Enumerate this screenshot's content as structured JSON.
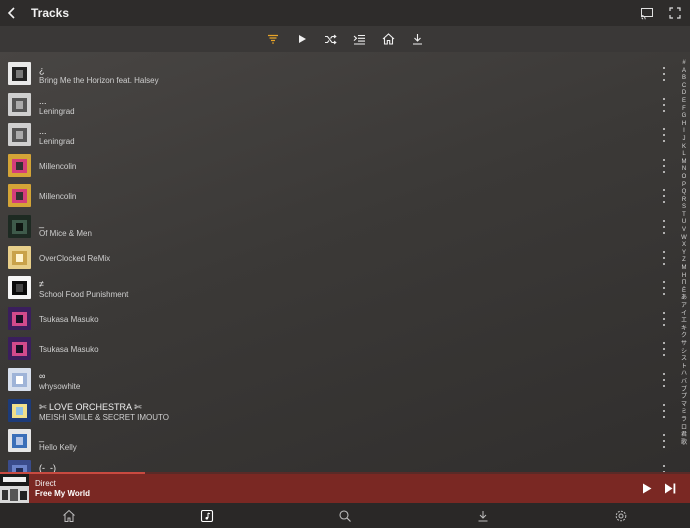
{
  "header": {
    "title": "Tracks"
  },
  "toolbar": {
    "buttons": [
      "sort-filter-icon",
      "play-icon",
      "shuffle-icon",
      "queue-icon",
      "home-icon",
      "download-icon"
    ]
  },
  "colors": {
    "accent": "#e8a428",
    "now_playing_bg": "#7a2823",
    "progress_fill": "#c94a40"
  },
  "tracks": [
    {
      "title": "¿",
      "artist": "Bring Me the Horizon feat. Halsey"
    },
    {
      "title": "...",
      "artist": "Leningrad"
    },
    {
      "title": "...",
      "artist": "Leningrad"
    },
    {
      "title": "",
      "artist": "Millencolin"
    },
    {
      "title": "",
      "artist": "Millencolin"
    },
    {
      "title": "_",
      "artist": "Of Mice & Men"
    },
    {
      "title": "",
      "artist": "OverClocked ReMix"
    },
    {
      "title": "≠",
      "artist": "School Food Punishment"
    },
    {
      "title": "",
      "artist": "Tsukasa Masuko"
    },
    {
      "title": "",
      "artist": "Tsukasa Masuko"
    },
    {
      "title": "∞",
      "artist": "whysowhite"
    },
    {
      "title": "✄ LOVE ORCHESTRA ✄",
      "artist": "MEISHI SMILE & SECRET IMOUTO"
    },
    {
      "title": "_",
      "artist": "Hello Kelly"
    },
    {
      "title": "(-_-)",
      "artist": ""
    }
  ],
  "index_letters": [
    "#",
    "A",
    "B",
    "C",
    "D",
    "E",
    "F",
    "G",
    "H",
    "I",
    "J",
    "K",
    "L",
    "M",
    "N",
    "O",
    "P",
    "Q",
    "R",
    "S",
    "T",
    "U",
    "V",
    "W",
    "X",
    "Y",
    "Z",
    "М",
    "Н",
    "П",
    "Ё",
    "あ",
    "ア",
    "イ",
    "エ",
    "キ",
    "ク",
    "サ",
    "シ",
    "ス",
    "ト",
    "ハ",
    "バ",
    "ブ",
    "プ",
    "マ",
    "ミ",
    "ラ",
    "ロ",
    "君",
    "歌"
  ],
  "now_playing": {
    "title": "Direct",
    "subtitle": "Free My World",
    "progress": 0.21
  },
  "bottom_nav": [
    "home-icon",
    "music-note-icon",
    "search-icon",
    "download-icon",
    "settings-icon"
  ]
}
